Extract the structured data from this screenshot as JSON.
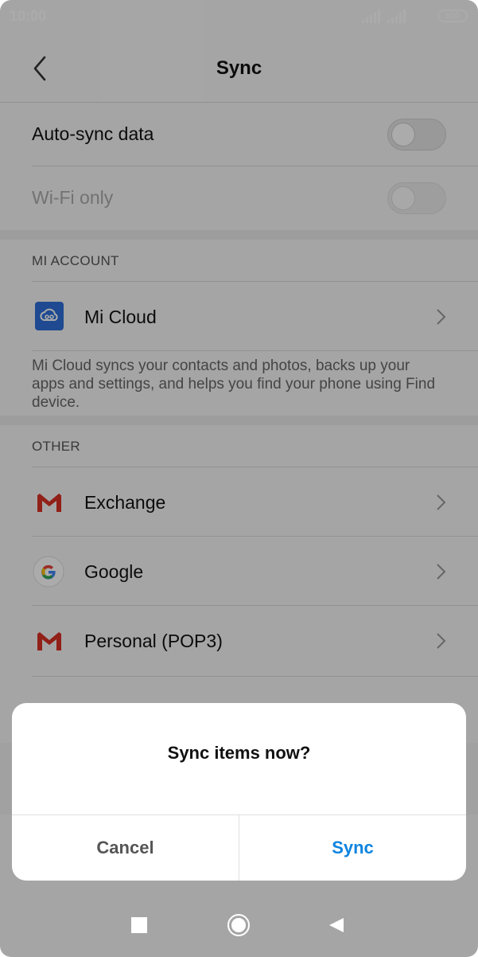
{
  "status_bar": {
    "time": "10:00",
    "battery": "100"
  },
  "header": {
    "title": "Sync"
  },
  "settings": {
    "auto_sync": {
      "label": "Auto-sync data",
      "enabled": false
    },
    "wifi_only": {
      "label": "Wi-Fi only",
      "enabled": false,
      "disabled": true
    }
  },
  "mi_account": {
    "title": "MI ACCOUNT",
    "item_label": "Mi Cloud",
    "description": "Mi Cloud syncs your contacts and photos, backs up your apps and settings, and helps you find your phone using Find device."
  },
  "other": {
    "title": "OTHER",
    "items": [
      {
        "label": "Exchange",
        "icon": "gmail-icon"
      },
      {
        "label": "Google",
        "icon": "google-icon"
      },
      {
        "label": "Personal (POP3)",
        "icon": "gmail-icon"
      }
    ]
  },
  "dialog": {
    "title": "Sync items now?",
    "cancel": "Cancel",
    "confirm": "Sync"
  },
  "colors": {
    "accent": "#0d84e0",
    "mi_cloud": "#2f6fd8",
    "gmail_red": "#d93025"
  }
}
